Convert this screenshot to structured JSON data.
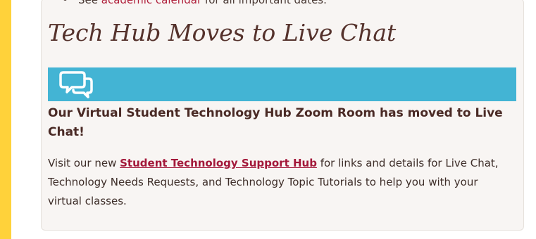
{
  "previous_item": {
    "prefix": "See ",
    "link_text": "academic calendar",
    "suffix": " for all important dates."
  },
  "section": {
    "title": "Tech Hub Moves to Live Chat",
    "banner_icon": "chat-bubbles-icon",
    "banner_color": "#43b4d4",
    "subheading": "Our Virtual Student Technology Hub Zoom Room has moved to Live Chat!",
    "body_prefix": "Visit our new ",
    "body_link": "Student Technology Support Hub",
    "body_suffix": " for links and details for Live Chat, Technology Needs Requests, and Technology Topic Tutorials to help you with your virtual classes."
  },
  "colors": {
    "page_background": "#ffd23a",
    "card_background": "#f8f5f3",
    "title": "#55322c",
    "link": "#a3183a"
  }
}
